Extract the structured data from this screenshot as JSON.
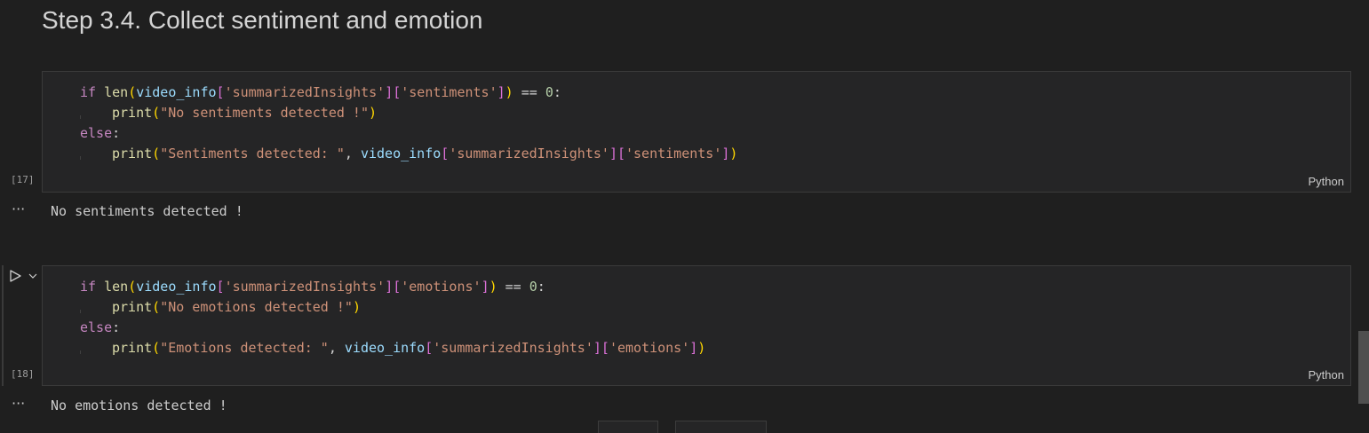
{
  "heading": "Step 3.4. Collect sentiment and emotion",
  "cells": [
    {
      "execution_count": "[17]",
      "language": "Python",
      "code": {
        "line1": {
          "kw": "if",
          "fn": "len",
          "var": "video_info",
          "key1": "'summarizedInsights'",
          "key2": "'sentiments'",
          "op": "==",
          "num": "0"
        },
        "line2": {
          "fn": "print",
          "str": "\"No sentiments detected !\""
        },
        "line3": {
          "kw": "else"
        },
        "line4": {
          "fn": "print",
          "str": "\"Sentiments detected: \"",
          "var": "video_info",
          "key1": "'summarizedInsights'",
          "key2": "'sentiments'"
        }
      },
      "output": "No sentiments detected !"
    },
    {
      "execution_count": "[18]",
      "language": "Python",
      "code": {
        "line1": {
          "kw": "if",
          "fn": "len",
          "var": "video_info",
          "key1": "'summarizedInsights'",
          "key2": "'emotions'",
          "op": "==",
          "num": "0"
        },
        "line2": {
          "fn": "print",
          "str": "\"No emotions detected !\""
        },
        "line3": {
          "kw": "else"
        },
        "line4": {
          "fn": "print",
          "str": "\"Emotions detected: \"",
          "var": "video_info",
          "key1": "'summarizedInsights'",
          "key2": "'emotions'"
        }
      },
      "output": "No emotions detected !"
    }
  ],
  "output_menu_glyph": "···",
  "icons": {
    "run": "play-icon",
    "expand": "chevron-down-icon"
  },
  "colors": {
    "background": "#1f1f1f",
    "cell_background": "#252526",
    "keyword": "#c586c0",
    "function": "#dcdcaa",
    "variable": "#9cdcfe",
    "string": "#ce9178",
    "number": "#b5cea8"
  }
}
